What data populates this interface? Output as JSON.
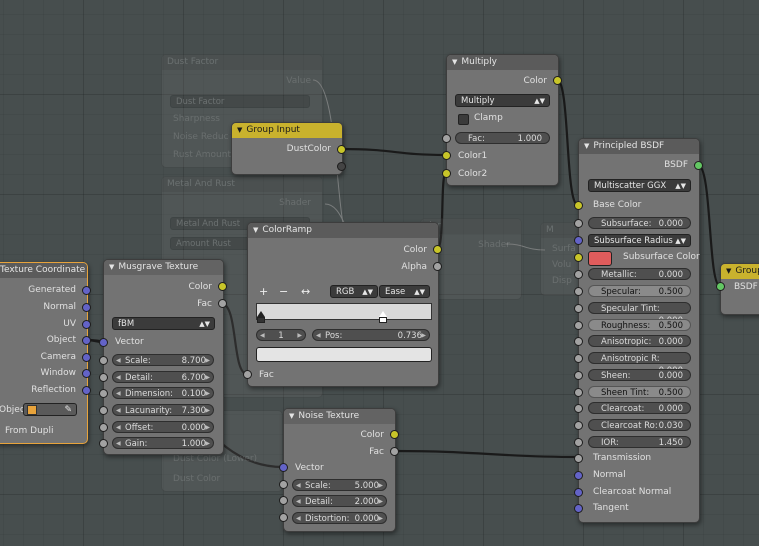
{
  "colors": {
    "background": "#474e4e",
    "node_body": "#737373",
    "group_header": "#c9b22d",
    "socket_color": "#c8c529",
    "socket_float": "#a2a2a2",
    "socket_vector": "#6363c7",
    "socket_shader": "#63c763",
    "base_color_swatch": "#e05c5c"
  },
  "ghost": {
    "dust_factor": {
      "title": "Dust Factor",
      "value_label": "Value",
      "field_dust_factor": "Dust Factor",
      "rows": [
        "Sharpness",
        "Noise Reduc",
        "Rust Amount"
      ]
    },
    "metal_rust": {
      "title": "Metal And Rust",
      "shader_label": "Shader",
      "fields": [
        "Metal And Rust",
        "Amount Rust"
      ],
      "extra": [
        "Dust Color (Lower)",
        "Dust Color"
      ]
    },
    "shader_node": {
      "title": "der",
      "shader_label": "Shader"
    },
    "mix_node": {
      "title": "M",
      "rows": [
        "Surfa",
        "Volu",
        "Disp"
      ]
    }
  },
  "texture_coordinate": {
    "title": "Texture Coordinate",
    "outputs": [
      "Generated",
      "Normal",
      "UV",
      "Object",
      "Camera",
      "Window",
      "Reflection"
    ],
    "object_label": "Objec",
    "from_dupli": "From Dupli"
  },
  "musgrave": {
    "title": "Musgrave Texture",
    "out_color": "Color",
    "out_fac": "Fac",
    "type": "fBM",
    "in_vector": "Vector",
    "fields": [
      {
        "label": "Scale:",
        "value": "8.700"
      },
      {
        "label": "Detail:",
        "value": "6.700"
      },
      {
        "label": "Dimension:",
        "value": "0.100"
      },
      {
        "label": "Lacunarity:",
        "value": "7.300"
      },
      {
        "label": "Offset:",
        "value": "0.000"
      },
      {
        "label": "Gain:",
        "value": "1.000"
      }
    ]
  },
  "group_input": {
    "title": "Group Input",
    "out_dust_color": "DustColor"
  },
  "color_ramp": {
    "title": "ColorRamp",
    "out_color": "Color",
    "out_alpha": "Alpha",
    "btn_add": "+",
    "btn_remove": "−",
    "btn_flip": "↔",
    "color_mode": "RGB",
    "interpolation": "Ease",
    "stop_index": "1",
    "pos_label": "Pos:",
    "pos_value": "0.736",
    "stop_positions": [
      0.0,
      0.736
    ],
    "in_fac": "Fac"
  },
  "multiply": {
    "title": "Multiply",
    "out_color": "Color",
    "blend": "Multiply",
    "clamp": "Clamp",
    "fac_label": "Fac:",
    "fac_value": "1.000",
    "in_color1": "Color1",
    "in_color2": "Color2"
  },
  "noise": {
    "title": "Noise Texture",
    "out_color": "Color",
    "out_fac": "Fac",
    "in_vector": "Vector",
    "fields": [
      {
        "label": "Scale:",
        "value": "5.000"
      },
      {
        "label": "Detail:",
        "value": "2.000"
      },
      {
        "label": "Distortion:",
        "value": "0.000"
      }
    ]
  },
  "principled": {
    "title": "Principled BSDF",
    "out_bsdf": "BSDF",
    "distribution": "Multiscatter GGX",
    "base_color": "Base Color",
    "subsurface_method": "Subsurface Radius",
    "subsurface_color": "Subsurface Color",
    "fields": [
      {
        "label": "Subsurface:",
        "value": "0.000",
        "hl": false
      },
      {
        "label": "Metallic:",
        "value": "0.000",
        "hl": false
      },
      {
        "label": "Specular:",
        "value": "0.500",
        "hl": true
      },
      {
        "label": "Specular Tint:",
        "value": "0.000",
        "hl": false
      },
      {
        "label": "Roughness:",
        "value": "0.500",
        "hl": true
      },
      {
        "label": "Anisotropic:",
        "value": "0.000",
        "hl": false
      },
      {
        "label": "Anisotropic R:",
        "value": "0.000",
        "hl": false
      },
      {
        "label": "Sheen:",
        "value": "0.000",
        "hl": false
      },
      {
        "label": "Sheen Tint:",
        "value": "0.500",
        "hl": true
      },
      {
        "label": "Clearcoat:",
        "value": "0.000",
        "hl": false
      },
      {
        "label": "Clearcoat Ro:",
        "value": "0.030",
        "hl": false
      },
      {
        "label": "IOR:",
        "value": "1.450",
        "hl": false
      }
    ],
    "inputs_bottom": [
      "Transmission",
      "Normal",
      "Clearcoat Normal",
      "Tangent"
    ]
  },
  "group_output": {
    "title": "Group",
    "in_bsdf": "BSDF"
  }
}
